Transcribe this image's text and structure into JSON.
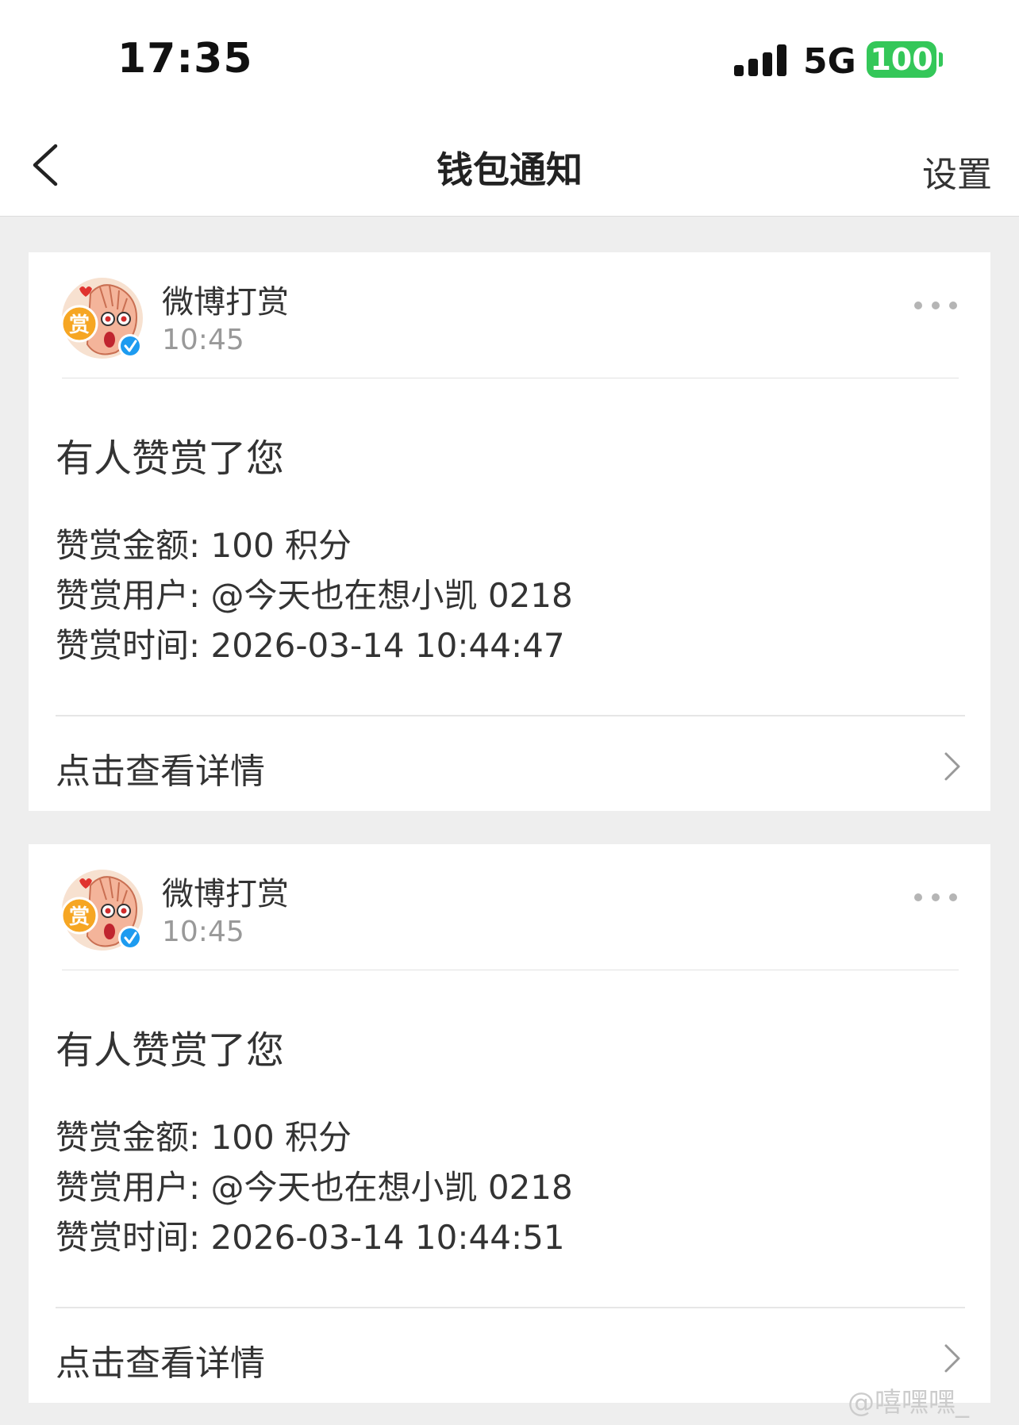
{
  "status_bar": {
    "time": "17:35",
    "network": "5G",
    "battery": "100",
    "battery_color": "#34c759"
  },
  "nav": {
    "back_icon": "chevron-left-icon",
    "title": "钱包通知",
    "settings_label": "设置"
  },
  "notifications": [
    {
      "sender": "微博打赏",
      "time": "10:45",
      "headline": "有人赞赏了您",
      "amount_line": "赞赏金额: 100 积分",
      "user_line": "赞赏用户: @今天也在想小凯 0218",
      "time_line": "赞赏时间: 2026-03-14 10:44:47",
      "details_label": "点击查看详情",
      "avatar_badge": "赏"
    },
    {
      "sender": "微博打赏",
      "time": "10:45",
      "headline": "有人赞赏了您",
      "amount_line": "赞赏金额: 100 积分",
      "user_line": "赞赏用户: @今天也在想小凯 0218",
      "time_line": "赞赏时间: 2026-03-14 10:44:51",
      "details_label": "点击查看详情",
      "avatar_badge": "赏"
    }
  ],
  "watermark": "@嘻嘿嘿_"
}
